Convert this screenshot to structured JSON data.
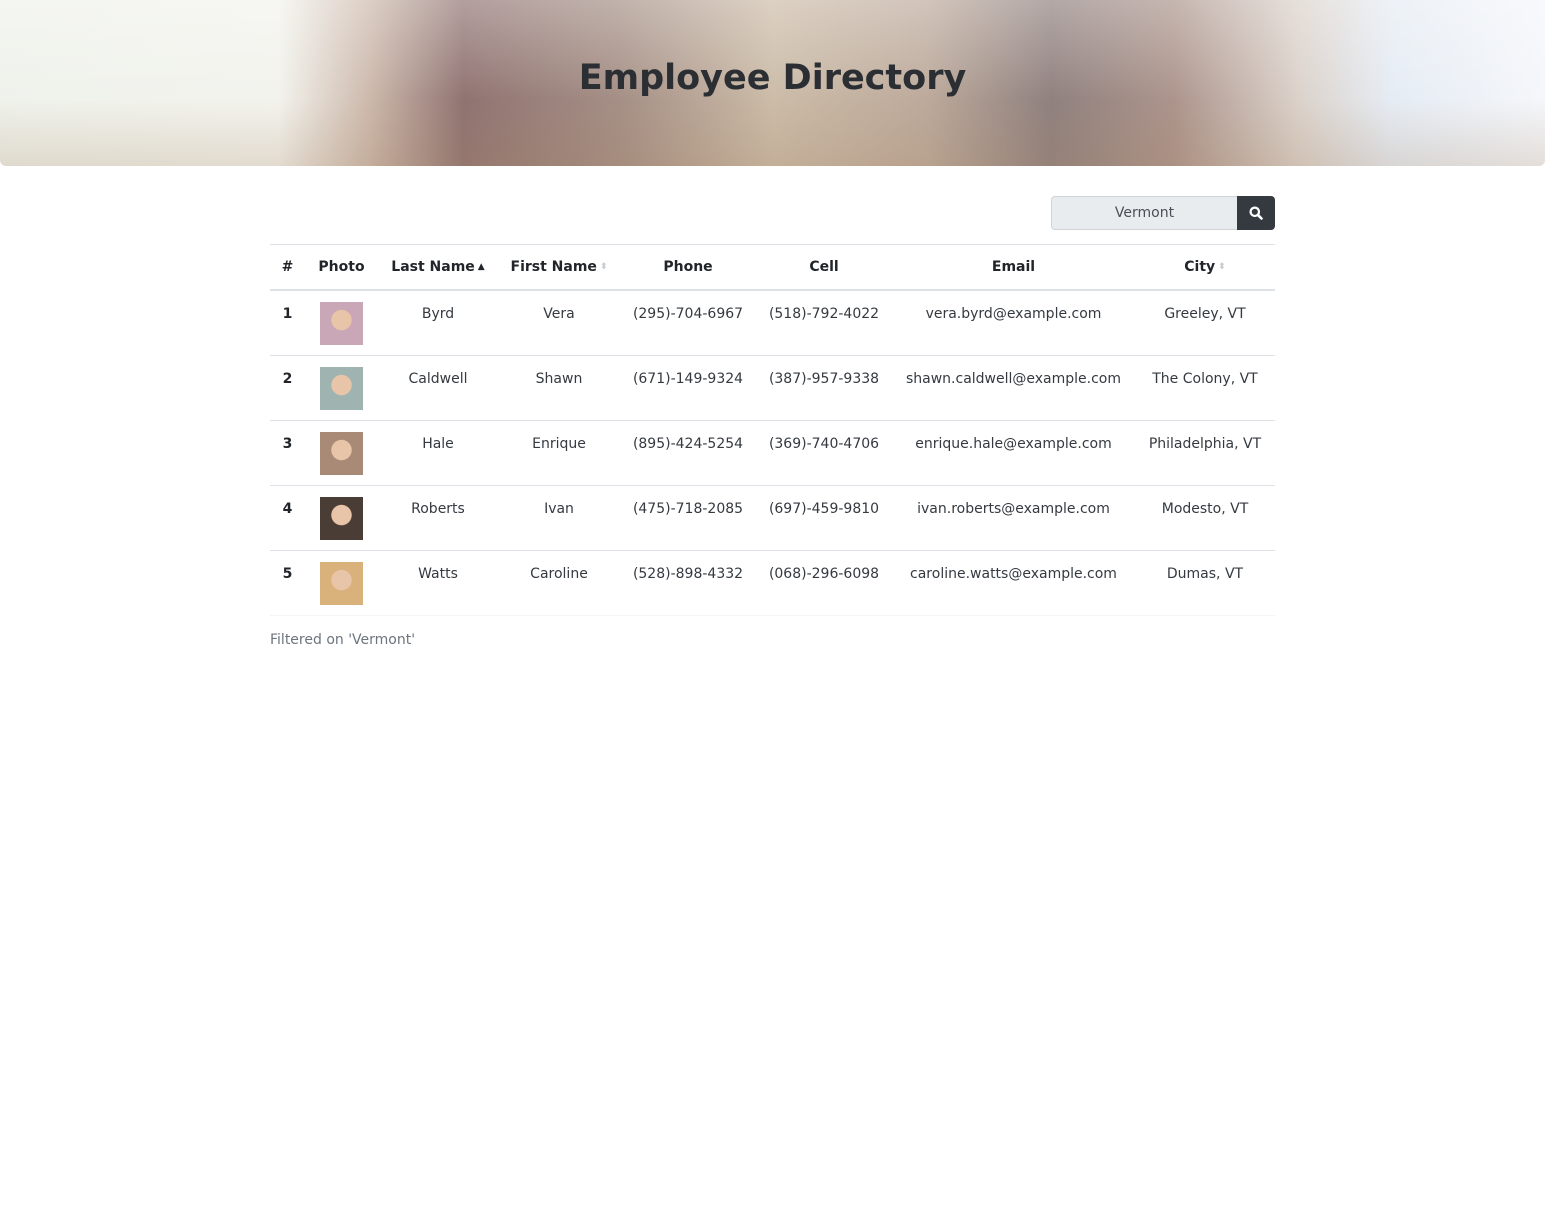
{
  "header": {
    "title": "Employee Directory"
  },
  "search": {
    "value": "Vermont",
    "icon": "search-icon"
  },
  "table": {
    "columns": [
      "#",
      "Photo",
      "Last Name",
      "First Name",
      "Phone",
      "Cell",
      "Email",
      "City"
    ],
    "sort_icons": {
      "last_name": "sort-up",
      "first_name": "sort",
      "city": "sort"
    },
    "rows": [
      {
        "num": "1",
        "last": "Byrd",
        "first": "Vera",
        "phone": "(295)-704-6967",
        "cell": "(518)-792-4022",
        "email": "vera.byrd@example.com",
        "city": "Greeley, VT",
        "photo_color": "#c9a7b6"
      },
      {
        "num": "2",
        "last": "Caldwell",
        "first": "Shawn",
        "phone": "(671)-149-9324",
        "cell": "(387)-957-9338",
        "email": "shawn.caldwell@example.com",
        "city": "The Colony, VT",
        "photo_color": "#9fb4b0"
      },
      {
        "num": "3",
        "last": "Hale",
        "first": "Enrique",
        "phone": "(895)-424-5254",
        "cell": "(369)-740-4706",
        "email": "enrique.hale@example.com",
        "city": "Philadelphia, VT",
        "photo_color": "#a88a76"
      },
      {
        "num": "4",
        "last": "Roberts",
        "first": "Ivan",
        "phone": "(475)-718-2085",
        "cell": "(697)-459-9810",
        "email": "ivan.roberts@example.com",
        "city": "Modesto, VT",
        "photo_color": "#4a3d36"
      },
      {
        "num": "5",
        "last": "Watts",
        "first": "Caroline",
        "phone": "(528)-898-4332",
        "cell": "(068)-296-6098",
        "email": "caroline.watts@example.com",
        "city": "Dumas, VT",
        "photo_color": "#d8b27a"
      }
    ]
  },
  "footer": {
    "text": "Filtered on 'Vermont'"
  }
}
